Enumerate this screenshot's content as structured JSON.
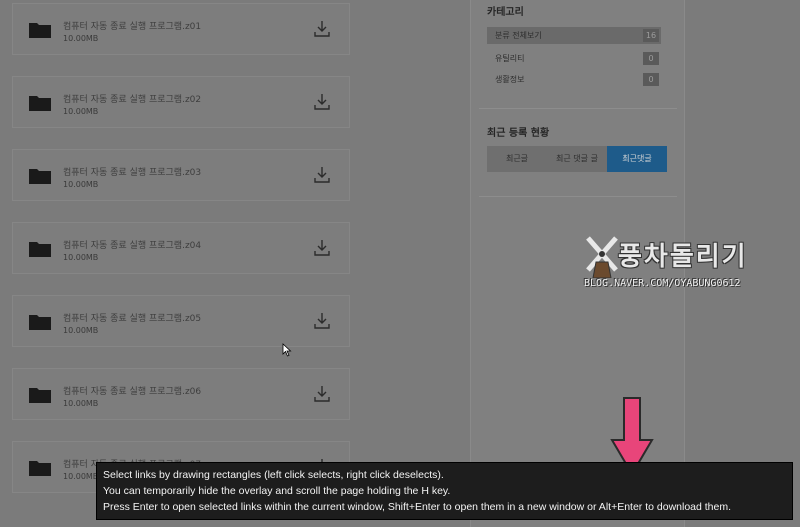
{
  "files": [
    {
      "name": "컴퓨터 자동 종료 실행 프로그램.z01",
      "size": "10.00MB"
    },
    {
      "name": "컴퓨터 자동 종료 실행 프로그램.z02",
      "size": "10.00MB"
    },
    {
      "name": "컴퓨터 자동 종료 실행 프로그램.z03",
      "size": "10.00MB"
    },
    {
      "name": "컴퓨터 자동 종료 실행 프로그램.z04",
      "size": "10.00MB"
    },
    {
      "name": "컴퓨터 자동 종료 실행 프로그램.z05",
      "size": "10.00MB"
    },
    {
      "name": "컴퓨터 자동 종료 실행 프로그램.z06",
      "size": "10.00MB"
    },
    {
      "name": "컴퓨터 자동 종료 실행 프로그램.z07",
      "size": "10.00MB"
    }
  ],
  "sidebar": {
    "category_title": "카테고리",
    "categories": [
      {
        "label": "분류 전체보기",
        "count": "16"
      },
      {
        "label": "유틸리티",
        "count": "0"
      },
      {
        "label": "생활정보",
        "count": "0"
      }
    ],
    "recent_title": "최근 등록 현황",
    "recent_tabs": [
      "최근글",
      "최근 댓글 글",
      "최근댓글"
    ],
    "active_recent_tab": 2
  },
  "watermark": {
    "title": "풍차돌리기",
    "url": "BLOG.NAVER.COM/OYABUNG0612"
  },
  "overlay": {
    "line1": "Select links by drawing rectangles (left click selects, right click deselects).",
    "line2": "You can temporarily hide the overlay and scroll the page holding the H key.",
    "line3": "Press Enter to open selected links within the current window, Shift+Enter to open them in a new window or Alt+Enter to download them."
  },
  "colors": {
    "accent": "#1e5b8a",
    "arrow": "#e8457a",
    "overlay_bg": "#1d1d1d"
  }
}
